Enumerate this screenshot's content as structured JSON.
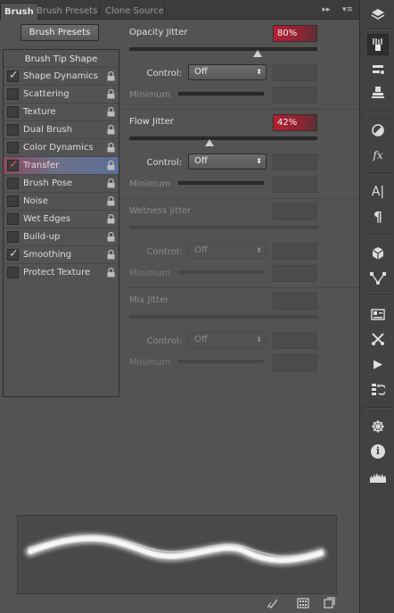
{
  "tabs": {
    "brush": "Brush",
    "brush_presets": "Brush Presets",
    "clone_source": "Clone Source",
    "expand": "▸▸",
    "menu": "▾≡"
  },
  "left": {
    "preset_button": "Brush Presets",
    "tip_shape": "Brush Tip Shape",
    "items": [
      {
        "label": "Shape Dynamics",
        "checked": true
      },
      {
        "label": "Scattering",
        "checked": false
      },
      {
        "label": "Texture",
        "checked": false
      },
      {
        "label": "Dual Brush",
        "checked": false
      },
      {
        "label": "Color Dynamics",
        "checked": false
      },
      {
        "label": "Transfer",
        "checked": true,
        "selected": true
      },
      {
        "label": "Brush Pose",
        "checked": false
      },
      {
        "label": "Noise",
        "checked": false
      },
      {
        "label": "Wet Edges",
        "checked": false
      },
      {
        "label": "Build-up",
        "checked": false
      },
      {
        "label": "Smoothing",
        "checked": true
      },
      {
        "label": "Protect Texture",
        "checked": false
      }
    ],
    "checkmark": "✓"
  },
  "opacity": {
    "title": "Opacity Jitter",
    "value": "80%",
    "slider_fraction": 0.8,
    "control_label": "Control:",
    "control_value": "Off",
    "minimum_label": "Minimum"
  },
  "flow": {
    "title": "Flow Jitter",
    "value": "42%",
    "slider_fraction": 0.42,
    "control_label": "Control:",
    "control_value": "Off",
    "minimum_label": "Minimum"
  },
  "wetness": {
    "title": "Wetness Jitter",
    "control_label": "Control:",
    "control_value": "Off",
    "minimum_label": "Minimum"
  },
  "mix": {
    "title": "Mix Jitter",
    "control_label": "Control:",
    "control_value": "Off",
    "minimum_label": "Minimum"
  },
  "select_arrow": "⬍",
  "colors": {
    "panel_bg": "#535353",
    "accent_red": "#b51f33",
    "selected_row": "#5b6f96"
  },
  "dock_icons": [
    "layers-icon",
    "brush-panel-icon",
    "brush-presets-icon",
    "clone-stamp-icon",
    "adjust-icon",
    "fx-icon",
    "character-icon",
    "paragraph-icon",
    "3d-icon",
    "path-icon",
    "properties-icon",
    "tools-icon",
    "actions-icon",
    "history-icon",
    "navigator-icon",
    "info-icon",
    "histogram-icon"
  ],
  "dock_glyphs": {
    "fx": "fx",
    "char": "A|",
    "para": "¶",
    "play": "▶",
    "info": "i"
  }
}
